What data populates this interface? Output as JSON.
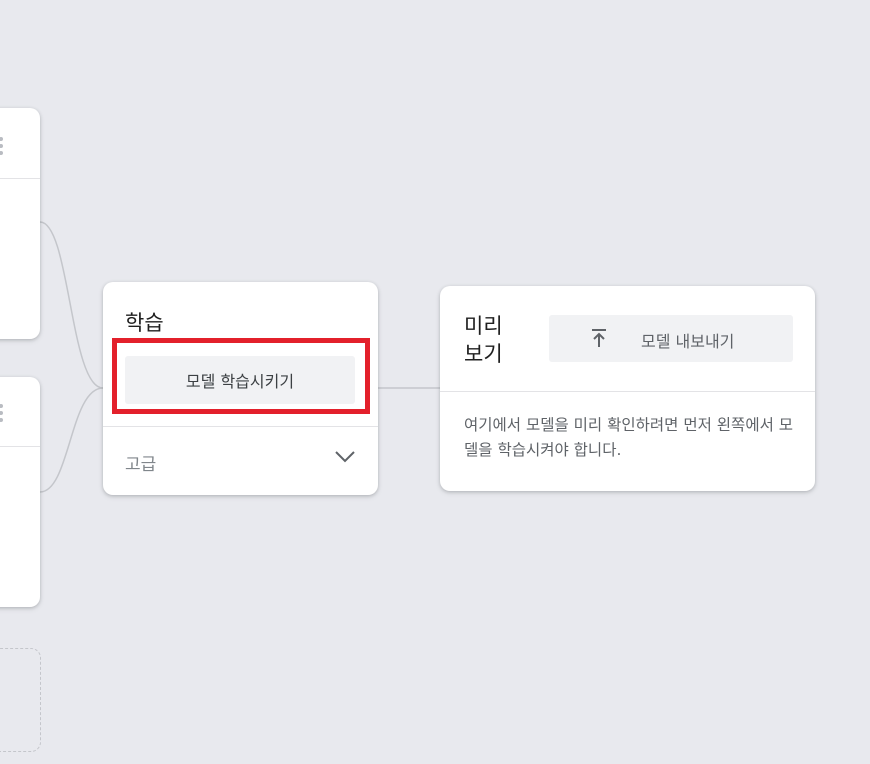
{
  "training": {
    "title": "학습",
    "train_button_label": "모델 학습시키기",
    "advanced_label": "고급"
  },
  "preview": {
    "title": "미리 보기",
    "export_button_label": "모델 내보내기",
    "description": "여기에서 모델을 미리 확인하려면 먼저 왼쪽에서 모델을 학습시켜야 합니다."
  },
  "icons": {
    "more": "more-vert-icon",
    "chevron": "chevron-down-icon",
    "export": "upload-icon"
  },
  "colors": {
    "background": "#e8e9ee",
    "card": "#ffffff",
    "highlight": "#e3202b",
    "button": "#f1f2f4"
  }
}
